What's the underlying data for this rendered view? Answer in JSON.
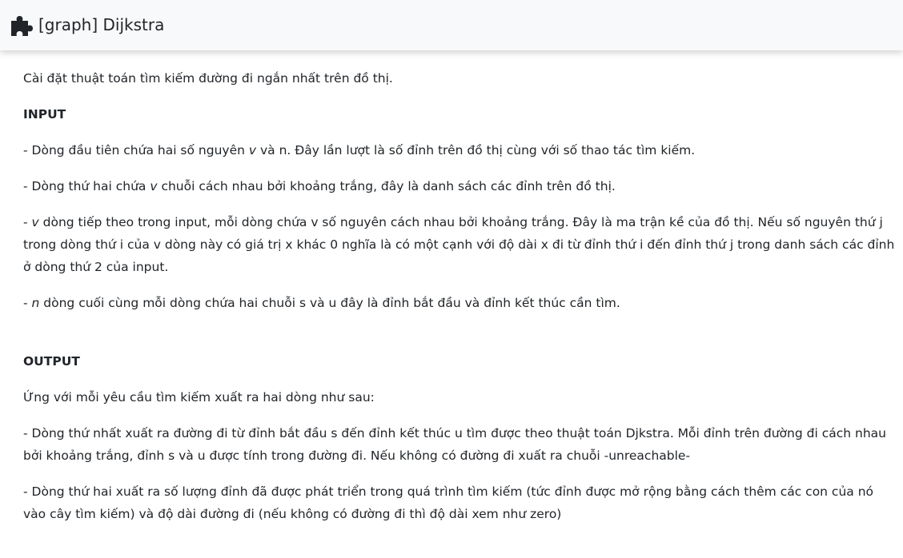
{
  "header": {
    "icon": "puzzle-piece-icon",
    "title": "[graph] Dijkstra"
  },
  "content": {
    "intro": "Cài đặt thuật toán tìm kiếm đường đi ngắn nhất trên đồ thị.",
    "input_heading": "INPUT",
    "input_line1": {
      "a": "- Dòng đầu tiên chứa hai số nguyên ",
      "v": "v",
      "b": " và n. Đây lần lượt là số đỉnh trên đồ thị cùng với số thao tác tìm kiếm."
    },
    "input_line2": {
      "a": "- Dòng thứ hai chứa ",
      "v": "v",
      "b": " chuỗi cách nhau bởi khoảng trắng, đây là danh sách các đỉnh trên đồ thị."
    },
    "input_line3": {
      "a": "- ",
      "v": "v",
      "b": " dòng tiếp theo trong input, mỗi dòng chứa v số nguyên cách nhau bởi khoảng trắng. Đây là ma trận kề của đồ thị. Nếu số nguyên thứ j trong dòng thứ i của v dòng này có giá trị x khác 0 nghĩa là có một cạnh với độ dài x đi từ đỉnh thứ i đến đỉnh thứ j trong danh sách các đỉnh ở dòng thứ 2 của input."
    },
    "input_line4": {
      "a": "- ",
      "n": "n",
      "b": " dòng cuối cùng mỗi dòng chứa hai chuỗi s và u đây là đỉnh bắt đầu và đỉnh kết thúc cần tìm."
    },
    "output_heading": "OUTPUT",
    "output_intro": "Ứng với mỗi yêu cầu tìm kiếm xuất ra hai dòng như sau:",
    "output_line1": "- Dòng thứ nhất xuất ra đường đi từ đỉnh bắt đầu s đến đỉnh kết thúc u tìm được theo thuật toán Djkstra. Mỗi đỉnh trên đường đi cách nhau bởi khoảng trắng, đỉnh s và u được tính trong đường đi. Nếu không có đường đi xuất ra chuỗi -unreachable-",
    "output_line2": "- Dòng thứ hai xuất ra số lượng đỉnh đã được phát triển trong quá trình tìm kiếm  (tức đỉnh được mở rộng bằng cách thêm các con của nó vào cây tìm kiếm)   và độ dài đường đi (nếu không có đường đi thì độ dài xem như zero)"
  }
}
